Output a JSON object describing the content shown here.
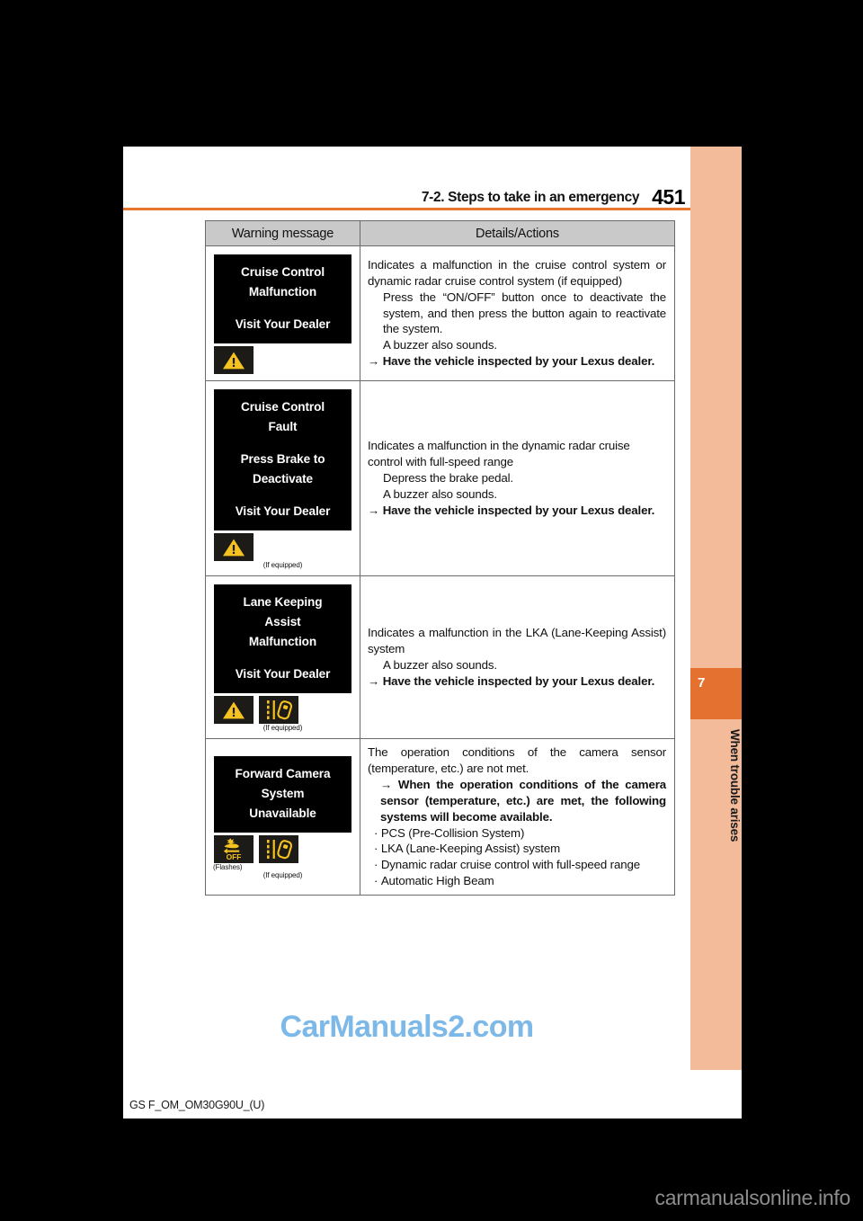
{
  "header": {
    "chapter_title": "7-2. Steps to take in an emergency",
    "page_number": "451"
  },
  "tab_strip": {
    "chapter_number": "7",
    "chapter_name": "When trouble arises",
    "accent_color": "#e4712f",
    "background_color": "#f4bb9b"
  },
  "table": {
    "columns": [
      "Warning message",
      "Details/Actions"
    ],
    "rows": [
      {
        "display": {
          "lines": [
            "Cruise Control",
            "Malfunction",
            "",
            "Visit Your Dealer"
          ]
        },
        "indicators": [
          {
            "icon": "warning-triangle-icon",
            "color": "#f5c220"
          }
        ],
        "footnotes": [],
        "details": {
          "intro": [
            "Indicates a malfunction in the cruise control system or dynamic radar cruise control system (if equipped)"
          ],
          "steps": [
            "Press the “ON/OFF” button once to deactivate the system, and then press the button again to reactivate the system.",
            "A buzzer also sounds."
          ],
          "action": "Have the vehicle inspected by your Lexus dealer.",
          "bullets": []
        }
      },
      {
        "display": {
          "lines": [
            "Cruise Control",
            "Fault",
            "",
            "Press Brake to",
            "Deactivate",
            "",
            "Visit Your Dealer"
          ]
        },
        "indicators": [
          {
            "icon": "warning-triangle-icon",
            "color": "#f5c220"
          }
        ],
        "footnotes": [
          "(If equipped)"
        ],
        "details": {
          "intro": [
            "Indicates a malfunction in the dynamic radar cruise control with full-speed range"
          ],
          "steps": [
            "Depress the brake pedal.",
            "A buzzer also sounds."
          ],
          "action": "Have the vehicle inspected by your Lexus dealer.",
          "bullets": []
        }
      },
      {
        "display": {
          "lines": [
            "Lane Keeping",
            "Assist",
            "Malfunction",
            "",
            "Visit Your Dealer"
          ]
        },
        "indicators": [
          {
            "icon": "warning-triangle-icon",
            "color": "#f5c220"
          },
          {
            "icon": "lane-departure-icon",
            "color": "#f5c220"
          }
        ],
        "footnotes": [
          "(If equipped)"
        ],
        "details": {
          "intro": [
            "Indicates a malfunction in the LKA (Lane-Keeping Assist) system"
          ],
          "steps": [
            "A buzzer also sounds."
          ],
          "action": "Have the vehicle inspected by your Lexus dealer.",
          "bullets": []
        }
      },
      {
        "display": {
          "lines": [
            "Forward Camera",
            "System",
            "Unavailable"
          ]
        },
        "indicators": [
          {
            "icon": "pcs-off-icon",
            "color": "#f5c220"
          },
          {
            "icon": "lane-departure-icon",
            "color": "#f5c220"
          }
        ],
        "footnotes": [
          "(Flashes)",
          "(If equipped)"
        ],
        "details": {
          "intro": [
            "The operation conditions of the camera sensor (temperature, etc.) are not met."
          ],
          "steps": [],
          "action": "When the operation conditions of the camera sensor (temperature, etc.) are met, the following systems will become available.",
          "bullets": [
            "PCS (Pre-Collision System)",
            "LKA (Lane-Keeping Assist) system",
            "Dynamic radar cruise control with full-speed range",
            "Automatic High Beam"
          ]
        }
      }
    ]
  },
  "watermark": "CarManuals2.com",
  "footer_code": "GS F_OM_OM30G90U_(U)",
  "corner_watermark": "carmanualsonline.info"
}
